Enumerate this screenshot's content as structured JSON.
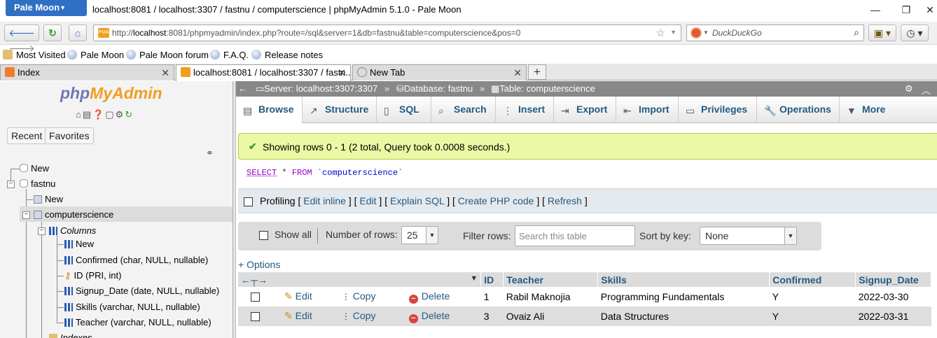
{
  "window": {
    "app_menu": "Pale Moon",
    "title": "localhost:8081 / localhost:3307 / fastnu / computerscience | phpMyAdmin 5.1.0 - Pale Moon"
  },
  "navbar": {
    "url_prefix": "http://",
    "url_host": "localhost",
    "url_rest": ":8081/phpmyadmin/index.php?route=/sql&server=1&db=fastnu&table=computerscience&pos=0",
    "search_engine_placeholder": "DuckDuckGo"
  },
  "bookmarks": [
    "Most Visited",
    "Pale Moon",
    "Pale Moon forum",
    "F.A.Q.",
    "Release notes"
  ],
  "tabs": [
    {
      "label": "Index"
    },
    {
      "label": "localhost:8081 / localhost:3307 / fastn..."
    },
    {
      "label": "New Tab"
    }
  ],
  "sidebar": {
    "logo_php": "php",
    "logo_myadmin": "MyAdmin",
    "buttons": [
      "Recent",
      "Favorites"
    ],
    "tree": {
      "new_root": "New",
      "database": "fastnu",
      "new_table": "New",
      "table": "computerscience",
      "columns_label": "Columns",
      "new_column": "New",
      "columns": [
        "Confirmed (char, NULL, nullable)",
        "ID (PRI, int)",
        "Signup_Date (date, NULL, nullable)",
        "Skills (varchar, NULL, nullable)",
        "Teacher (varchar, NULL, nullable)"
      ],
      "indexes_label": "Indexes"
    }
  },
  "breadcrumb": {
    "server": "Server: localhost:3307:3307",
    "database": "Database: fastnu",
    "table": "Table: computerscience"
  },
  "menu_tabs": [
    "Browse",
    "Structure",
    "SQL",
    "Search",
    "Insert",
    "Export",
    "Import",
    "Privileges",
    "Operations",
    "More"
  ],
  "result": {
    "message": "Showing rows 0 - 1 (2 total, Query took 0.0008 seconds.)",
    "sql_select": "SELECT",
    "sql_star": "*",
    "sql_from": "FROM",
    "sql_table": "`computerscience`"
  },
  "profiling": {
    "label": "Profiling",
    "links": [
      "Edit inline",
      "Edit",
      "Explain SQL",
      "Create PHP code",
      "Refresh"
    ]
  },
  "rows_nav": {
    "show_all": "Show all",
    "rows_label": "Number of rows:",
    "rows_value": "25",
    "filter_label": "Filter rows:",
    "filter_placeholder": "Search this table",
    "sort_label": "Sort by key:",
    "sort_value": "None"
  },
  "options_link": "+ Options",
  "table": {
    "headers": [
      "ID",
      "Teacher",
      "Skills",
      "Confirmed",
      "Signup_Date"
    ],
    "actions": {
      "edit": "Edit",
      "copy": "Copy",
      "delete": "Delete"
    },
    "rows": [
      {
        "id": "1",
        "teacher": "Rabil Maknojia",
        "skills": "Programming Fundamentals",
        "confirmed": "Y",
        "signup_date": "2022-03-30"
      },
      {
        "id": "3",
        "teacher": "Ovaiz Ali",
        "skills": "Data Structures",
        "confirmed": "Y",
        "signup_date": "2022-03-31"
      }
    ]
  },
  "colors": {
    "link": "#235a81",
    "success_bg": "#ebf8a4",
    "breadcrumb_bg": "#888888",
    "browser_accent": "#2f6fc4"
  }
}
